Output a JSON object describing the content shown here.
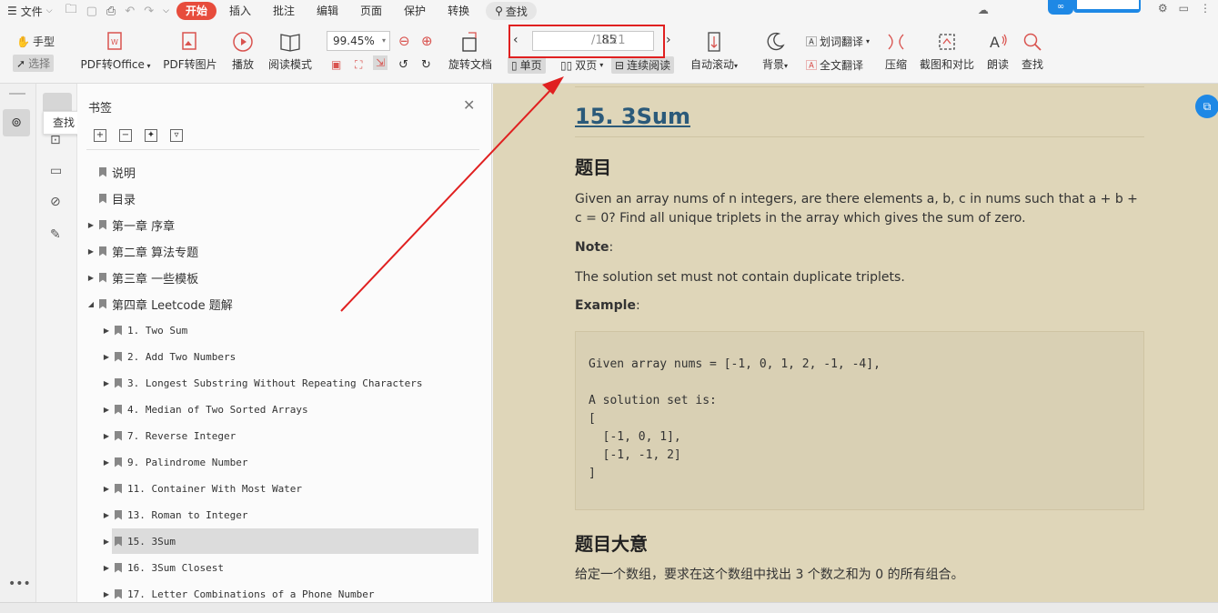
{
  "menubar": {
    "file_label": "文件",
    "tabs": [
      "开始",
      "插入",
      "批注",
      "编辑",
      "页面",
      "保护",
      "转换"
    ],
    "active_tab": "开始",
    "search_label": "查找"
  },
  "toolbar": {
    "hand_label": "手型",
    "select_label": "选择",
    "pdf_to_office": "PDF转Office",
    "pdf_to_image": "PDF转图片",
    "play": "播放",
    "read_mode": "阅读模式",
    "zoom_value": "99.45%",
    "rotate_doc": "旋转文档",
    "page_current": "85",
    "page_total": "/1121",
    "single_page": "单页",
    "double_page": "双页",
    "continuous": "连续阅读",
    "auto_scroll": "自动滚动",
    "background": "背景",
    "word_translate": "划词翻译",
    "full_translate": "全文翻译",
    "compress": "压缩",
    "screenshot_compare": "截图和对比",
    "read_aloud": "朗读",
    "find": "查找"
  },
  "colors": {
    "accent": "#e74c3c",
    "doc_bg": "#dfd6b9",
    "link_title": "#2b5a7a",
    "annotation_red": "#e02020"
  },
  "sidebar": {
    "tooltip": "查找",
    "panel_title": "书签"
  },
  "bookmarks": [
    {
      "label": "说明",
      "level": 0,
      "arrow": "",
      "mono": false
    },
    {
      "label": "目录",
      "level": 0,
      "arrow": "",
      "mono": false
    },
    {
      "label": "第一章 序章",
      "level": 0,
      "arrow": "▶",
      "mono": false
    },
    {
      "label": "第二章 算法专题",
      "level": 0,
      "arrow": "▶",
      "mono": false
    },
    {
      "label": "第三章 一些模板",
      "level": 0,
      "arrow": "▶",
      "mono": false
    },
    {
      "label": "第四章 Leetcode 题解",
      "level": 0,
      "arrow": "◢",
      "mono": false
    },
    {
      "label": "1. Two Sum",
      "level": 1,
      "arrow": "▶",
      "mono": true
    },
    {
      "label": "2. Add Two Numbers",
      "level": 1,
      "arrow": "▶",
      "mono": true
    },
    {
      "label": "3. Longest Substring Without Repeating Characters",
      "level": 1,
      "arrow": "▶",
      "mono": true
    },
    {
      "label": "4. Median of Two Sorted Arrays",
      "level": 1,
      "arrow": "▶",
      "mono": true
    },
    {
      "label": "7. Reverse Integer",
      "level": 1,
      "arrow": "▶",
      "mono": true
    },
    {
      "label": "9. Palindrome Number",
      "level": 1,
      "arrow": "▶",
      "mono": true
    },
    {
      "label": "11. Container With Most Water",
      "level": 1,
      "arrow": "▶",
      "mono": true
    },
    {
      "label": "13. Roman to Integer",
      "level": 1,
      "arrow": "▶",
      "mono": true
    },
    {
      "label": "15. 3Sum",
      "level": 1,
      "arrow": "▶",
      "mono": true,
      "selected": true
    },
    {
      "label": "16. 3Sum Closest",
      "level": 1,
      "arrow": "▶",
      "mono": true
    },
    {
      "label": "17. Letter Combinations of a Phone Number",
      "level": 1,
      "arrow": "▶",
      "mono": true
    }
  ],
  "doc": {
    "title": "15. 3Sum",
    "h_problem": "题目",
    "problem_text": "Given an array nums of n integers, are there elements a, b, c in nums such that a + b + c = 0? Find all unique triplets in the array which gives the sum of zero.",
    "note_label": "Note",
    "note_colon": ":",
    "note_text": "The solution set must not contain duplicate triplets.",
    "example_label": "Example",
    "example_colon": ":",
    "code": "Given array nums = [-1, 0, 1, 2, -1, -4],\n\nA solution set is:\n[\n  [-1, 0, 1],\n  [-1, -1, 2]\n]",
    "h_meaning": "题目大意",
    "meaning_text": "给定一个数组，要求在这个数组中找出 3 个数之和为 0 的所有组合。"
  }
}
